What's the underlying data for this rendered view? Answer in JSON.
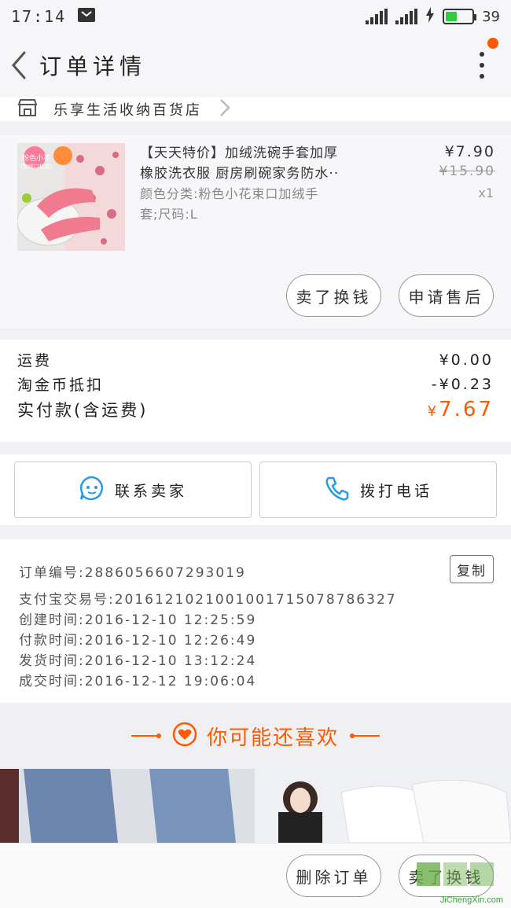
{
  "status_bar": {
    "time": "17:14",
    "battery": "39"
  },
  "header": {
    "title": "订单详情"
  },
  "store": {
    "name": "乐享生活收纳百货店"
  },
  "product": {
    "image_badge": "粉色小花",
    "image_badge_sub": "(加绒口松紧)",
    "title_line1": "【天天特价】加绒洗碗手套加厚",
    "title_line2": "橡胶洗衣服 厨房刷碗家务防水··",
    "sku_line1": "颜色分类:粉色小花束口加绒手",
    "sku_line2": "套;尺码:L",
    "price": "¥7.90",
    "original_price": "¥15.90",
    "quantity": "x1",
    "btn_buy_again": "卖了换钱",
    "btn_after_sale": "申请售后"
  },
  "summary": {
    "shipping_label": "运费",
    "shipping_value": "¥0.00",
    "coin_label": "淘金币抵扣",
    "coin_value": "-¥0.23",
    "total_label": "实付款(含运费)",
    "total_currency": "¥",
    "total_value": "7.67"
  },
  "contact": {
    "seller": "联系卖家",
    "call": "拨打电话"
  },
  "order_info": {
    "order_no": "订单编号:2886056607293019",
    "copy": "复制",
    "alipay_no": "支付宝交易号:2016121021001001715078786327",
    "created": "创建时间:2016-12-10 12:25:59",
    "paid": "付款时间:2016-12-10 12:26:49",
    "shipped": "发货时间:2016-12-10 13:12:24",
    "completed": "成交时间:2016-12-12 19:06:04"
  },
  "recommend": {
    "title": "你可能还喜欢"
  },
  "bottom": {
    "delete": "删除订单",
    "sell": "卖了换钱"
  },
  "watermark": {
    "text": "JiChengXin.com"
  },
  "colors": {
    "accent": "#ff5a00",
    "blue": "#2a9be4"
  }
}
